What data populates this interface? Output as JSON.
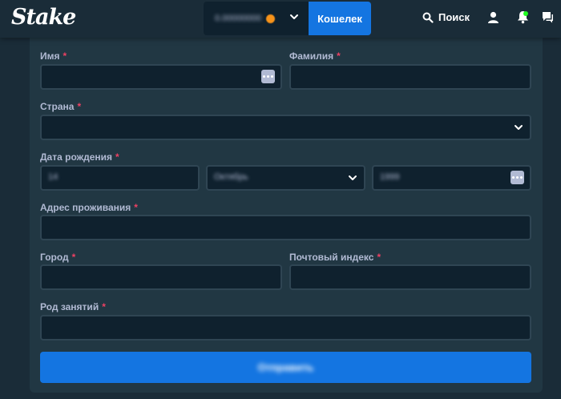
{
  "header": {
    "logo": "Stake",
    "balance_amount": "0.00000000",
    "wallet_label": "Кошелек",
    "search_label": "Поиск"
  },
  "form": {
    "first_name": {
      "label": "Имя",
      "required": "*"
    },
    "last_name": {
      "label": "Фамилия",
      "required": "*"
    },
    "country": {
      "label": "Страна",
      "required": "*"
    },
    "dob": {
      "label": "Дата рождения",
      "required": "*",
      "day": "14",
      "month": "Октябрь",
      "year": "1999"
    },
    "address": {
      "label": "Адрес проживания",
      "required": "*"
    },
    "city": {
      "label": "Город",
      "required": "*"
    },
    "postal": {
      "label": "Почтовый индекс",
      "required": "*"
    },
    "occupation": {
      "label": "Род занятий",
      "required": "*"
    },
    "submit_label": "Отправить"
  },
  "colors": {
    "background": "#1a2c38",
    "card": "#213743",
    "input": "#0f212e",
    "input_border": "#2f4553",
    "accent": "#1475e1",
    "label": "#b1bad3",
    "required": "#ed4163"
  }
}
